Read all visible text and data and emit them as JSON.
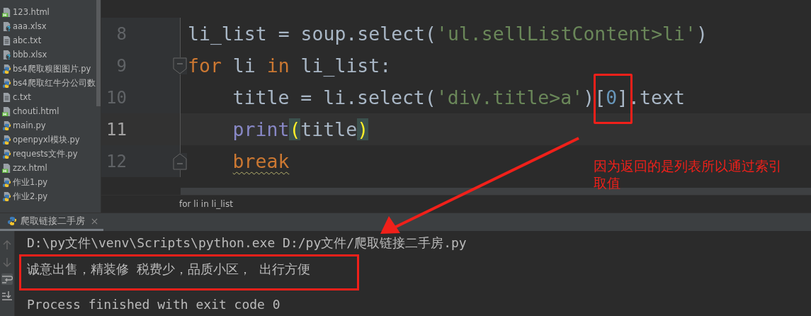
{
  "project_files": [
    {
      "name": "123.html",
      "kind": "html"
    },
    {
      "name": "aaa.xlsx",
      "kind": "unknown"
    },
    {
      "name": "abc.txt",
      "kind": "text"
    },
    {
      "name": "bbb.xlsx",
      "kind": "unknown"
    },
    {
      "name": "bs4爬取糗图图片.py",
      "kind": "python"
    },
    {
      "name": "bs4爬取红牛分公司数",
      "kind": "python"
    },
    {
      "name": "c.txt",
      "kind": "text"
    },
    {
      "name": "chouti.html",
      "kind": "html"
    },
    {
      "name": "main.py",
      "kind": "python"
    },
    {
      "name": "openpyxl模块.py",
      "kind": "python"
    },
    {
      "name": "requests文件.py",
      "kind": "python"
    },
    {
      "name": "zzx.html",
      "kind": "html"
    },
    {
      "name": "作业1.py",
      "kind": "python"
    },
    {
      "name": "作业2.py",
      "kind": "python"
    }
  ],
  "editor": {
    "lines": [
      {
        "number": "8",
        "current": false,
        "indented": false,
        "fold_start": false,
        "fold_end": false,
        "tokens": [
          {
            "text": "li_list = soup.select(",
            "kind": "plain",
            "boxed": false
          },
          {
            "text": "'ul.sellListContent>li'",
            "kind": "string",
            "boxed": false
          },
          {
            "text": ")",
            "kind": "plain",
            "boxed": false
          }
        ]
      },
      {
        "number": "9",
        "current": false,
        "indented": false,
        "fold_start": true,
        "fold_end": false,
        "tokens": [
          {
            "text": "for",
            "kind": "keyword",
            "boxed": false
          },
          {
            "text": " li ",
            "kind": "plain",
            "boxed": false
          },
          {
            "text": "in",
            "kind": "keyword",
            "boxed": false
          },
          {
            "text": " li_list:",
            "kind": "plain",
            "boxed": false
          }
        ]
      },
      {
        "number": "10",
        "current": false,
        "indented": true,
        "fold_start": false,
        "fold_end": false,
        "tokens": [
          {
            "text": "title = li.select(",
            "kind": "plain",
            "boxed": false
          },
          {
            "text": "'div.title>a'",
            "kind": "string",
            "boxed": false
          },
          {
            "text": ")",
            "kind": "plain",
            "boxed": false
          },
          {
            "text": "[0]",
            "kind": "subscript",
            "boxed": true
          },
          {
            "text": ".text",
            "kind": "plain",
            "boxed": false
          }
        ]
      },
      {
        "number": "11",
        "current": true,
        "indented": true,
        "fold_start": false,
        "fold_end": false,
        "tokens": [
          {
            "text": "print",
            "kind": "builtin",
            "boxed": false
          },
          {
            "text": "(",
            "kind": "brace",
            "boxed": false
          },
          {
            "text": "title",
            "kind": "plain",
            "boxed": false
          },
          {
            "text": ")",
            "kind": "brace",
            "boxed": false
          }
        ]
      },
      {
        "number": "12",
        "current": false,
        "indented": true,
        "fold_start": false,
        "fold_end": true,
        "tokens": [
          {
            "text": "break",
            "kind": "warned-keyword",
            "boxed": false
          }
        ]
      }
    ],
    "breadcrumb": "for li in li_list"
  },
  "annotation": "因为返回的是列表所以通过索引取值",
  "run_tab": {
    "title": "爬取链接二手房",
    "selected": true
  },
  "console": [
    {
      "text": "D:\\py文件\\venv\\Scripts\\python.exe D:/py文件/爬取链接二手房.py",
      "boxed": false
    },
    {
      "text": "诚意出售，精装修 税费少，品质小区， 出行方便",
      "boxed": true
    },
    {
      "text": "Process finished with exit code 0",
      "boxed": false
    }
  ]
}
